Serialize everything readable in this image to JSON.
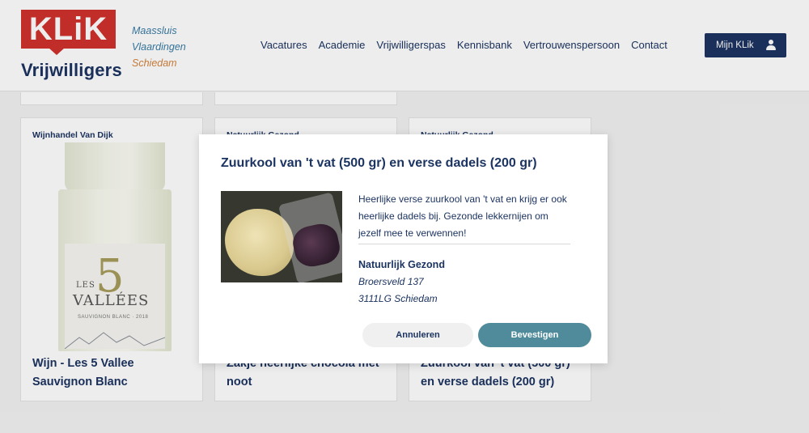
{
  "header": {
    "logo_text": "KLiK",
    "logo_subtitle": "Vrijwilligers",
    "towns": [
      "Maassluis",
      "Vlaardingen",
      "Schiedam"
    ],
    "nav": [
      "Vacatures",
      "Academie",
      "Vrijwilligerspas",
      "Kennisbank",
      "Vertrouwenspersoon",
      "Contact"
    ],
    "account_button": "Mijn KLik"
  },
  "cards": [
    {
      "vendor": "Wijnhandel Van Dijk",
      "title": "Wijn - Les 5 Vallee Sauvignon Blanc",
      "bottle_label": {
        "number": "5",
        "les": "LES",
        "name": "VALLÉES",
        "sub": "SAUVIGNON BLANC · 2018"
      }
    },
    {
      "vendor": "Natuurlijk Gezond",
      "title": "Zakje heerlijke chocola met noot"
    },
    {
      "vendor": "Natuurlijk Gezond",
      "title": "Zuurkool van 't vat (500 gr) en verse dadels (200 gr)"
    }
  ],
  "modal": {
    "title": "Zuurkool van 't vat (500 gr) en verse dadels (200 gr)",
    "description": "Heerlijke verse zuurkool van 't vat en krijg er ook heerlijke dadels bij. Gezonde lekkernijen om jezelf mee te verwennen!",
    "vendor": "Natuurlijk Gezond",
    "address_line1": "Broersveld 137",
    "address_line2": "3111LG Schiedam",
    "cancel_label": "Annuleren",
    "confirm_label": "Bevestigen"
  },
  "colors": {
    "brand_navy": "#1c3461",
    "brand_red": "#d0312d",
    "confirm": "#4f8b9a",
    "town_blue": "#3a7ca5",
    "town_orange": "#d4833d"
  }
}
